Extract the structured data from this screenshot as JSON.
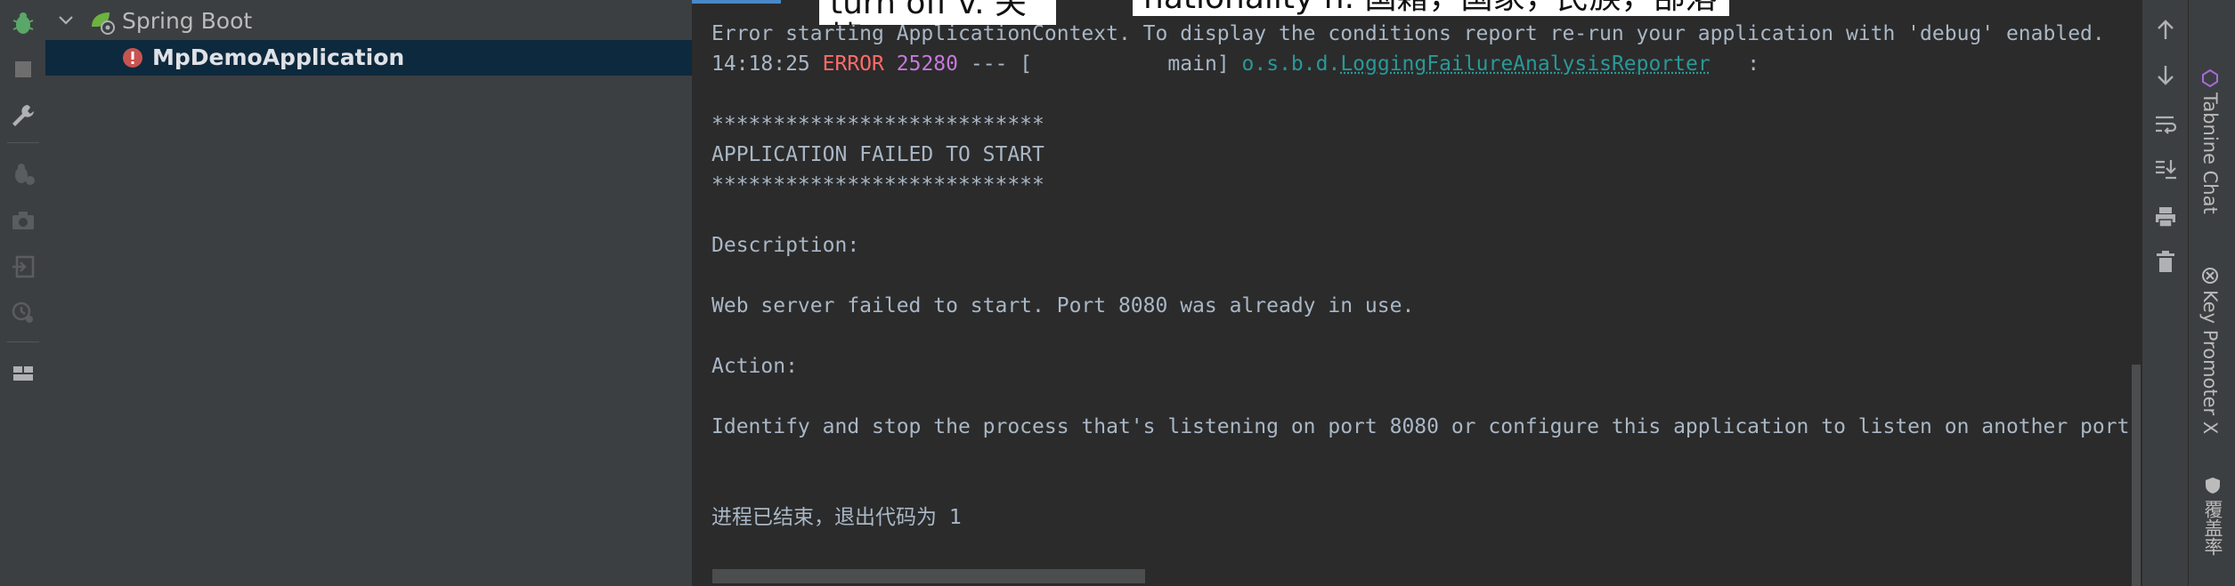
{
  "tool_strip": {
    "icons": [
      "debug-bug-icon",
      "stop-icon",
      "wrench-icon",
      "debug-disabled-icon",
      "camera-icon",
      "login-icon",
      "profiler-icon",
      "layout-icon"
    ]
  },
  "services_tree": {
    "root_label": "Spring Boot",
    "selected_label": "MpDemoApplication"
  },
  "overlays": {
    "left_caption": "turn off  v. 关掉",
    "right_caption": "nationality  n. 国籍，国家，民族，部落"
  },
  "console": {
    "line1": "Error starting ApplicationContext. To display the conditions report re-run your application with 'debug' enabled.",
    "line2_time": "14:18:25",
    "line2_level": "ERROR",
    "line2_pid": "25280",
    "line2_sep": "--- [",
    "line2_thread": "           main]",
    "line2_logger_prefix": "o.s.b.d.",
    "line2_logger_name": "LoggingFailureAnalysisReporter",
    "line2_tail": "   :",
    "stars1": "***************************",
    "failed_title": "APPLICATION FAILED TO START",
    "stars2": "***************************",
    "description_label": "Description:",
    "description_text": "Web server failed to start. Port 8080 was already in use.",
    "action_label": "Action:",
    "action_text": "Identify and stop the process that's listening on port 8080 or configure this application to listen on another port.",
    "exit_text": "进程已结束，退出代码为 1"
  },
  "console_toolbar": {
    "icons": [
      "arrow-up-icon",
      "arrow-down-icon",
      "soft-wrap-icon",
      "scroll-to-end-icon",
      "print-icon",
      "trash-icon"
    ]
  },
  "right_bar": {
    "tabs": [
      "Tabnine Chat",
      "Key Promoter X",
      "覆盖率"
    ]
  },
  "colors": {
    "error": "#ff6b68",
    "pid": "#c678dd",
    "logger": "#299999",
    "selection": "#0d293e"
  }
}
